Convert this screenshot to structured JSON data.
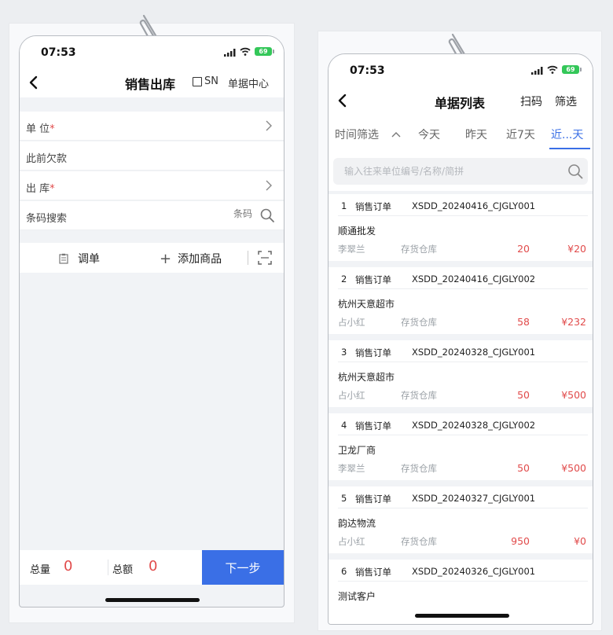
{
  "colors": {
    "accent": "#3a6fe6",
    "red": "#e14b4b",
    "battery": "#34c759"
  },
  "status": {
    "time": "07:53",
    "battery": "69"
  },
  "left": {
    "title": "销售出库",
    "sn_label": "SN",
    "doc_center": "单据中心",
    "rows": {
      "unit_label": "单  位",
      "arrears_label": "此前欠款",
      "warehouse_label": "出  库",
      "barcode_label": "条码搜索",
      "barcode_placeholder": "条码"
    },
    "toolbar": {
      "adjust_label": "调单",
      "add_label": "添加商品"
    },
    "footer": {
      "qty_label": "总量",
      "qty_value": "0",
      "amount_label": "总额",
      "amount_value": "0",
      "next_label": "下一步"
    }
  },
  "right": {
    "title": "单据列表",
    "scan_label": "扫码",
    "filter_label": "筛选",
    "time_filter": {
      "label": "时间筛选",
      "options": [
        "今天",
        "昨天",
        "近7天",
        "近...天"
      ],
      "selected": "近...天"
    },
    "search_placeholder": "输入往来单位编号/名称/简拼",
    "orders": [
      {
        "index": "1",
        "type": "销售订单",
        "code": "XSDD_20240416_CJGLY001",
        "customer": "顺通批发",
        "person": "李翠兰",
        "warehouse": "存货仓库",
        "qty": "20",
        "amount": "¥20"
      },
      {
        "index": "2",
        "type": "销售订单",
        "code": "XSDD_20240416_CJGLY002",
        "customer": "杭州天意超市",
        "person": "占小红",
        "warehouse": "存货仓库",
        "qty": "58",
        "amount": "¥232"
      },
      {
        "index": "3",
        "type": "销售订单",
        "code": "XSDD_20240328_CJGLY001",
        "customer": "杭州天意超市",
        "person": "占小红",
        "warehouse": "存货仓库",
        "qty": "50",
        "amount": "¥500"
      },
      {
        "index": "4",
        "type": "销售订单",
        "code": "XSDD_20240328_CJGLY002",
        "customer": "卫龙厂商",
        "person": "李翠兰",
        "warehouse": "存货仓库",
        "qty": "50",
        "amount": "¥500"
      },
      {
        "index": "5",
        "type": "销售订单",
        "code": "XSDD_20240327_CJGLY001",
        "customer": "韵达物流",
        "person": "占小红",
        "warehouse": "存货仓库",
        "qty": "950",
        "amount": "¥0"
      },
      {
        "index": "6",
        "type": "销售订单",
        "code": "XSDD_20240326_CJGLY001",
        "customer": "测试客户"
      }
    ]
  }
}
